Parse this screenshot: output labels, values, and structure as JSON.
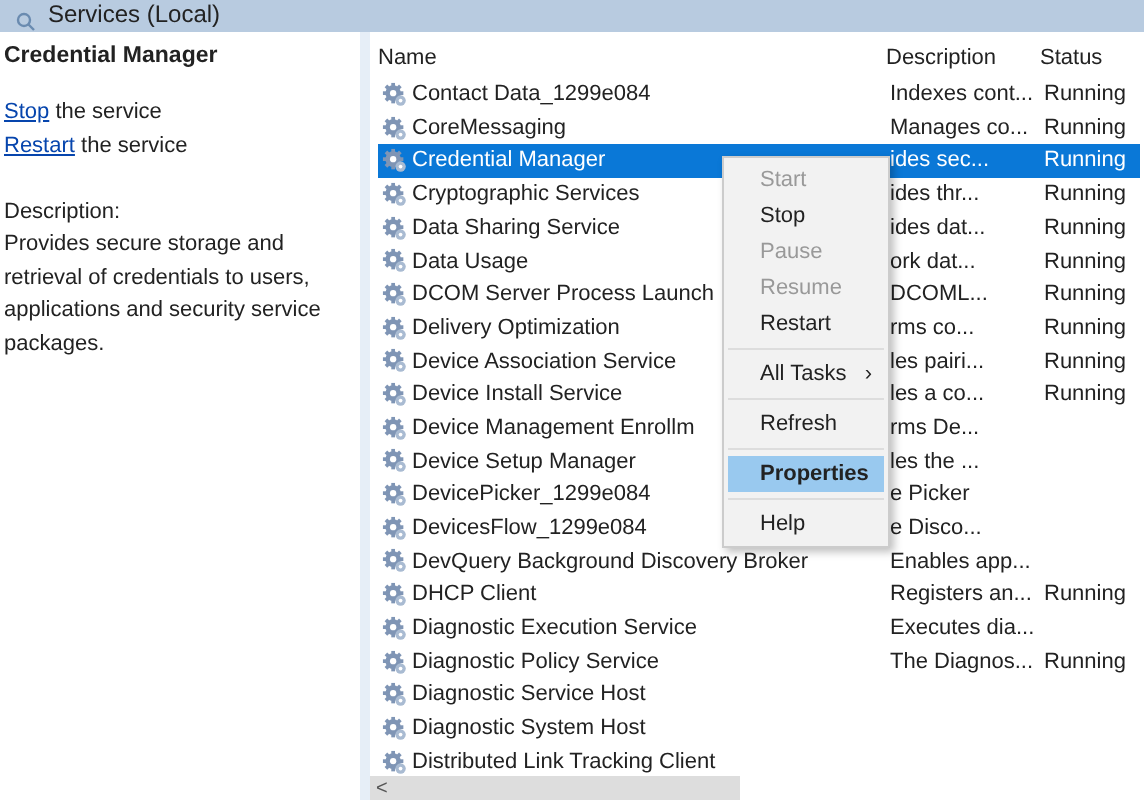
{
  "pane_title": "Services (Local)",
  "details": {
    "title": "Credential Manager",
    "actions": [
      {
        "link": "Stop",
        "text": "the service"
      },
      {
        "link": "Restart",
        "text": "the service"
      }
    ],
    "description_label": "Description:",
    "description": "Provides secure storage and retrieval of credentials to users, applications and security service packages."
  },
  "table": {
    "columns": [
      "Name",
      "Description",
      "Status"
    ],
    "rows": [
      {
        "name": "Contact Data_1299e084",
        "description": "Indexes cont...",
        "status": "Running",
        "selected": false
      },
      {
        "name": "CoreMessaging",
        "description": "Manages co...",
        "status": "Running",
        "selected": false
      },
      {
        "name": "Credential Manager",
        "description": "ides sec...",
        "status": "Running",
        "selected": true
      },
      {
        "name": "Cryptographic Services",
        "description": "ides thr...",
        "status": "Running",
        "selected": false
      },
      {
        "name": "Data Sharing Service",
        "description": "ides dat...",
        "status": "Running",
        "selected": false
      },
      {
        "name": "Data Usage",
        "description": "ork dat...",
        "status": "Running",
        "selected": false
      },
      {
        "name": "DCOM Server Process Launch",
        "description": "DCOML...",
        "status": "Running",
        "selected": false
      },
      {
        "name": "Delivery Optimization",
        "description": "rms co...",
        "status": "Running",
        "selected": false
      },
      {
        "name": "Device Association Service",
        "description": "les pairi...",
        "status": "Running",
        "selected": false
      },
      {
        "name": "Device Install Service",
        "description": "les a co...",
        "status": "Running",
        "selected": false
      },
      {
        "name": "Device Management Enrollm",
        "description": "rms De...",
        "status": "",
        "selected": false
      },
      {
        "name": "Device Setup Manager",
        "description": "les the ...",
        "status": "",
        "selected": false
      },
      {
        "name": "DevicePicker_1299e084",
        "description": "e Picker",
        "status": "",
        "selected": false
      },
      {
        "name": "DevicesFlow_1299e084",
        "description": "e Disco...",
        "status": "",
        "selected": false
      },
      {
        "name": "DevQuery Background Discovery Broker",
        "description": "Enables app...",
        "status": "",
        "selected": false
      },
      {
        "name": "DHCP Client",
        "description": "Registers an...",
        "status": "Running",
        "selected": false
      },
      {
        "name": "Diagnostic Execution Service",
        "description": "Executes dia...",
        "status": "",
        "selected": false
      },
      {
        "name": "Diagnostic Policy Service",
        "description": "The Diagnos...",
        "status": "Running",
        "selected": false
      },
      {
        "name": "Diagnostic Service Host",
        "description": "",
        "status": "",
        "selected": false
      },
      {
        "name": "Diagnostic System Host",
        "description": "",
        "status": "",
        "selected": false
      },
      {
        "name": "Distributed Link Tracking Client",
        "description": "",
        "status": "",
        "selected": false
      }
    ]
  },
  "scroll_left": "<",
  "context_menu": [
    {
      "kind": "item",
      "label": "Start",
      "disabled": true,
      "selected": false
    },
    {
      "kind": "item",
      "label": "Stop",
      "disabled": false,
      "selected": false
    },
    {
      "kind": "item",
      "label": "Pause",
      "disabled": true,
      "selected": false
    },
    {
      "kind": "item",
      "label": "Resume",
      "disabled": true,
      "selected": false
    },
    {
      "kind": "item",
      "label": "Restart",
      "disabled": false,
      "selected": false
    },
    {
      "kind": "separator"
    },
    {
      "kind": "submenu",
      "label": "All Tasks",
      "arrow": "›",
      "disabled": false,
      "selected": false
    },
    {
      "kind": "separator"
    },
    {
      "kind": "item",
      "label": "Refresh",
      "disabled": false,
      "selected": false
    },
    {
      "kind": "separator"
    },
    {
      "kind": "item",
      "label": "Properties",
      "disabled": false,
      "selected": true,
      "default": true
    },
    {
      "kind": "separator"
    },
    {
      "kind": "item",
      "label": "Help",
      "disabled": false,
      "selected": false
    }
  ]
}
